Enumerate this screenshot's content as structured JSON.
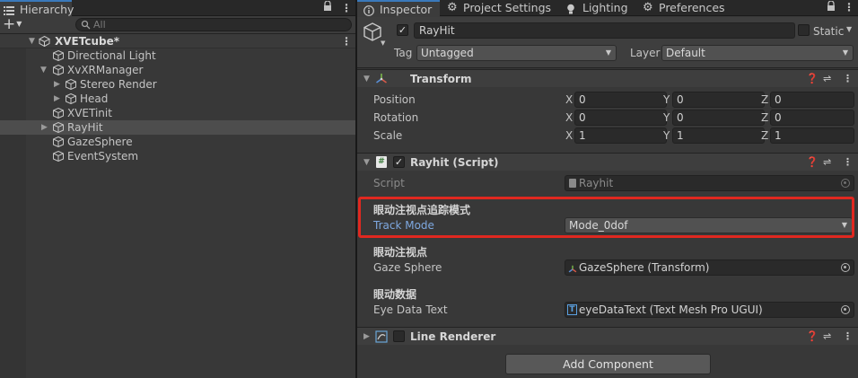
{
  "hierarchy": {
    "tab_label": "Hierarchy",
    "search_placeholder": "All",
    "add_label": "+",
    "items": [
      {
        "name": "XVETcube*",
        "depth": 0
      },
      {
        "name": "Directional Light",
        "depth": 1
      },
      {
        "name": "XvXRManager",
        "depth": 1
      },
      {
        "name": "Stereo Render",
        "depth": 2
      },
      {
        "name": "Head",
        "depth": 2
      },
      {
        "name": "XVETinit",
        "depth": 1
      },
      {
        "name": "RayHit",
        "depth": 1
      },
      {
        "name": "GazeSphere",
        "depth": 1
      },
      {
        "name": "EventSystem",
        "depth": 1
      }
    ]
  },
  "tabs": {
    "inspector": "Inspector",
    "project_settings": "Project Settings",
    "lighting": "Lighting",
    "preferences": "Preferences"
  },
  "object": {
    "name": "RayHit",
    "static_label": "Static",
    "tag_label": "Tag",
    "tag_value": "Untagged",
    "layer_label": "Layer",
    "layer_value": "Default"
  },
  "transform": {
    "title": "Transform",
    "position_label": "Position",
    "rotation_label": "Rotation",
    "scale_label": "Scale",
    "axis_x": "X",
    "axis_y": "Y",
    "axis_z": "Z",
    "position": [
      "0",
      "0",
      "0"
    ],
    "rotation": [
      "0",
      "0",
      "0"
    ],
    "scale": [
      "1",
      "1",
      "1"
    ]
  },
  "script": {
    "title": "Rayhit (Script)",
    "script_label": "Script",
    "script_value": "Rayhit",
    "header_track": "眼动注视点追踪模式",
    "track_mode_label": "Track Mode",
    "track_mode_value": "Mode_0dof",
    "header_gaze": "眼动注视点",
    "gaze_sphere_label": "Gaze Sphere",
    "gaze_sphere_value": "GazeSphere (Transform)",
    "header_data": "眼动数据",
    "eye_data_label": "Eye Data Text",
    "eye_data_value": "eyeDataText (Text Mesh Pro UGUI)"
  },
  "line_renderer": {
    "title": "Line Renderer"
  },
  "add_component_label": "Add Component",
  "colors": {
    "highlight": "#e02820",
    "accent": "#3a79bb",
    "blue_label": "#7ea8e0"
  }
}
